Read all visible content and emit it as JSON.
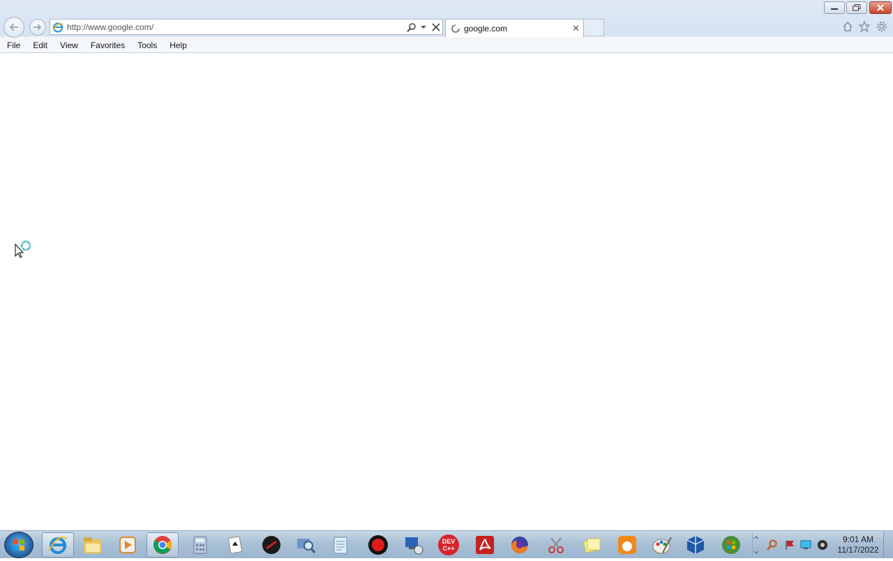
{
  "window": {
    "controls": {
      "minimize": "minimize-icon",
      "restore": "restore-icon",
      "close": "close-icon"
    }
  },
  "address_bar": {
    "url": "http://www.google.com/"
  },
  "tabs": [
    {
      "title": "google.com",
      "loading": true
    }
  ],
  "toolbar_icons": [
    "home-icon",
    "star-icon",
    "gear-icon"
  ],
  "menu": {
    "file": "File",
    "edit": "Edit",
    "view": "View",
    "favorites": "Favorites",
    "tools": "Tools",
    "help": "Help"
  },
  "taskbar": {
    "pinned": [
      "internet-explorer-icon",
      "windows-explorer-icon",
      "media-player-icon",
      "chrome-icon",
      "calculator-icon",
      "solitaire-icon",
      "game-icon",
      "magnifier-icon",
      "notepad-icon",
      "record-icon",
      "remote-desktop-icon",
      "devcpp-icon",
      "acrobat-icon",
      "firefox-icon",
      "snipping-tool-icon",
      "sticky-notes-icon",
      "uc-browser-icon",
      "paint-icon",
      "virtualbox-icon",
      "windows-icon"
    ],
    "devcpp_label_top": "DEV",
    "devcpp_label_bottom": "C++"
  },
  "clock": {
    "time": "9:01 AM",
    "date": "11/17/2022"
  },
  "colors": {
    "accent": "#2a6db0",
    "close_red": "#c8452c",
    "taskbar": "#a9c0d6"
  }
}
